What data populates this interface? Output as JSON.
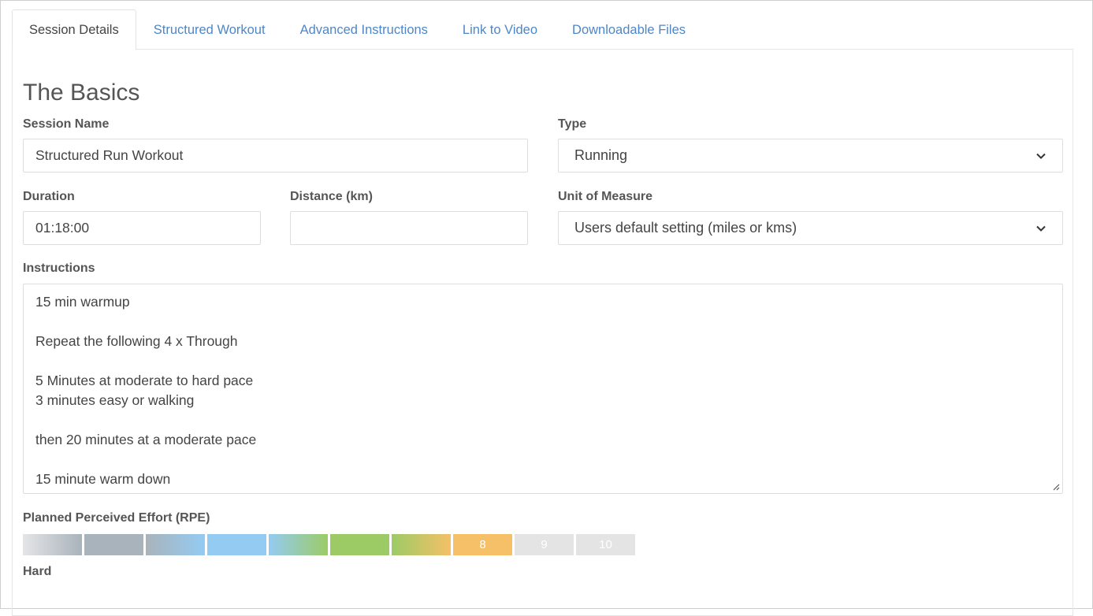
{
  "tabs": [
    {
      "label": "Session Details",
      "active": true
    },
    {
      "label": "Structured Workout",
      "active": false
    },
    {
      "label": "Advanced Instructions",
      "active": false
    },
    {
      "label": "Link to Video",
      "active": false
    },
    {
      "label": "Downloadable Files",
      "active": false
    }
  ],
  "section_title": "The Basics",
  "form": {
    "session_name": {
      "label": "Session Name",
      "value": "Structured Run Workout"
    },
    "type": {
      "label": "Type",
      "value": "Running"
    },
    "duration": {
      "label": "Duration",
      "value": "01:18:00"
    },
    "distance": {
      "label": "Distance (km)",
      "value": ""
    },
    "unit_of_measure": {
      "label": "Unit of Measure",
      "value": "Users default setting (miles or kms)"
    },
    "instructions": {
      "label": "Instructions",
      "lines": [
        "15 min warmup",
        "",
        "Repeat the following 4 x Through",
        "",
        "5 Minutes at moderate to hard pace",
        "3 minutes easy or walking",
        "",
        "then 20 minutes at a moderate pace",
        "",
        "15 minute warm down"
      ]
    }
  },
  "rpe": {
    "label": "Planned Perceived Effort (RPE)",
    "selected": 8,
    "descriptor": "Hard",
    "segments": [
      {
        "label": "",
        "background": "linear-gradient(to right, #e4e5e7, #a9b3bb)"
      },
      {
        "label": "",
        "background": "#a9b3bb"
      },
      {
        "label": "",
        "background": "linear-gradient(to right, #a9b3bb, #94cbf2)"
      },
      {
        "label": "",
        "background": "#94cbf2"
      },
      {
        "label": "",
        "background": "linear-gradient(to right, #94cbf2, #9ccb66)"
      },
      {
        "label": "",
        "background": "#9ccb66"
      },
      {
        "label": "",
        "background": "linear-gradient(to right, #9ccb66, #f5c067)"
      },
      {
        "label": "8",
        "background": "#f5c067"
      },
      {
        "label": "9",
        "background": "#e4e4e4"
      },
      {
        "label": "10",
        "background": "#e4e4e4"
      }
    ]
  },
  "colors": {
    "link": "#4f86c6",
    "text": "#444444",
    "border": "#dedede"
  }
}
